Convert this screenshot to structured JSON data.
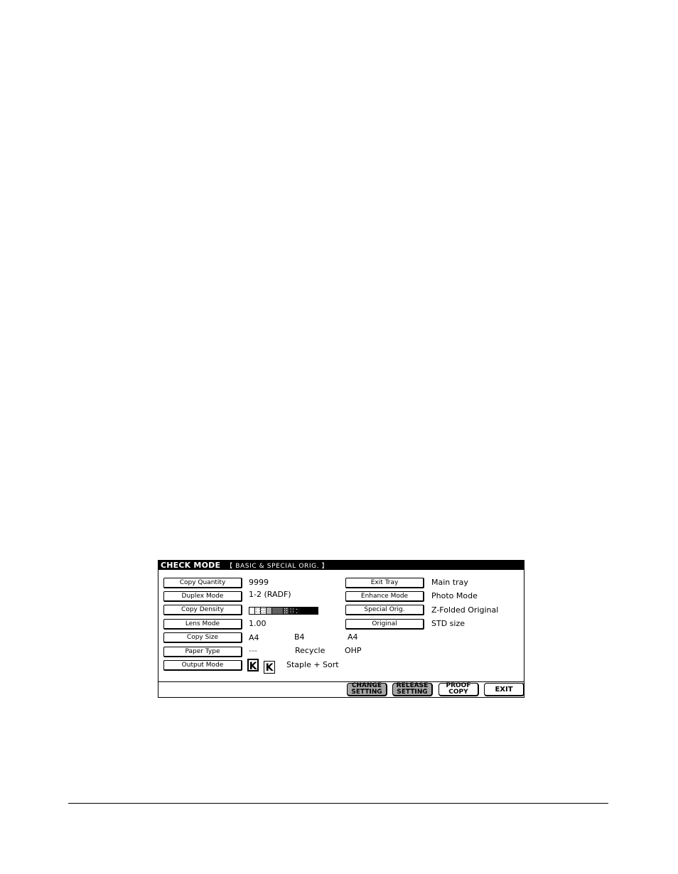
{
  "panel": {
    "title": "CHECK MODE",
    "subtitle": "【 BASIC & SPECIAL ORIG. 】",
    "left_rows": [
      {
        "button": "Copy Quantity",
        "values": [
          "9999"
        ]
      },
      {
        "button": "Duplex Mode",
        "values": [
          "1-2  (RADF)"
        ]
      },
      {
        "button": "Copy Density",
        "values": []
      },
      {
        "button": "Lens Mode",
        "values": [
          "1.00"
        ]
      },
      {
        "button": "Copy Size",
        "values": [
          "A4",
          "B4",
          "A4"
        ]
      },
      {
        "button": "Paper Type",
        "values": [
          "---",
          "Recycle",
          "OHP"
        ]
      },
      {
        "button": "Output Mode",
        "values": [
          "Staple + Sort"
        ]
      }
    ],
    "right_rows": [
      {
        "button": "Exit Tray",
        "value": "Main tray"
      },
      {
        "button": "Enhance Mode",
        "value": "Photo Mode"
      },
      {
        "button": "Special Orig.",
        "value": "Z-Folded Original"
      },
      {
        "button": "Original",
        "value": "STD size"
      }
    ],
    "density": {
      "levels": 9,
      "selected_level": 5
    },
    "output_icons": [
      {
        "glyph": "K",
        "icon": "staple-corner-icon",
        "active": true
      },
      {
        "glyph": "K",
        "icon": "sort-icon",
        "active": false
      }
    ],
    "footer_buttons": [
      {
        "line1": "CHANGE",
        "line2": "SETTING",
        "disabled": true
      },
      {
        "line1": "RELEASE",
        "line2": "SETTING",
        "disabled": true
      },
      {
        "line1": "PROOF",
        "line2": "COPY",
        "disabled": false
      },
      {
        "line1": "EXIT",
        "line2": "",
        "disabled": false
      }
    ]
  }
}
